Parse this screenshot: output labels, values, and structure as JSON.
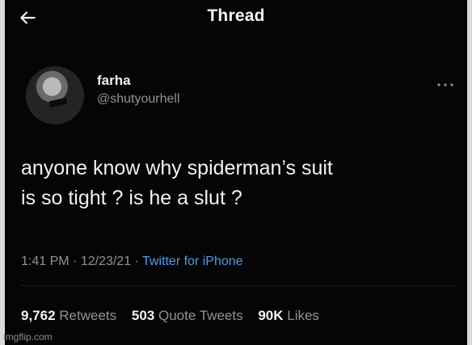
{
  "header": {
    "title": "Thread"
  },
  "tweet": {
    "name": "farha",
    "handle": "@shutyourhell",
    "text_line1": "anyone know why spiderman’s suit",
    "text_line2": "is so tight ? is he a slut ?",
    "time": "1:41 PM",
    "sep1": " · ",
    "date": "12/23/21",
    "sep2": " · ",
    "source": "Twitter for iPhone",
    "stats": {
      "retweets_count": "9,762",
      "retweets_label": "Retweets",
      "quotes_count": "503",
      "quotes_label": "Quote Tweets",
      "likes_count": "90K",
      "likes_label": "Likes"
    }
  },
  "watermark": "imgflip.com",
  "colors": {
    "background": "#050505",
    "text": "#f1f1f1",
    "muted": "#8b949b",
    "link": "#4f9ee8"
  },
  "icons": [
    "back-arrow-icon",
    "more-options-icon"
  ]
}
